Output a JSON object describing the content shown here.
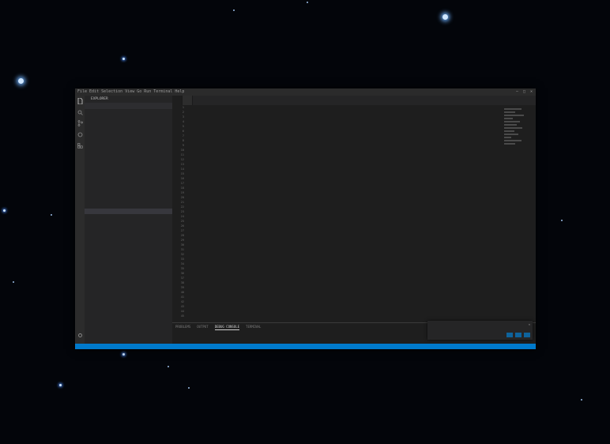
{
  "titlebar": {
    "menu": [
      "File",
      "Edit",
      "Selection",
      "View",
      "Go",
      "Run",
      "Terminal",
      "Help"
    ],
    "window_title": "",
    "controls": [
      "–",
      "□",
      "✕"
    ]
  },
  "activitybar": {
    "icons": [
      "files-icon",
      "search-icon",
      "source-control-icon",
      "debug-icon",
      "extensions-icon"
    ]
  },
  "sidebar": {
    "header": "EXPLORER",
    "section": "",
    "tree": [
      {
        "label": "",
        "indent": 6
      },
      {
        "label": "",
        "indent": 10
      },
      {
        "label": "",
        "indent": 10
      },
      {
        "label": "",
        "indent": 14
      },
      {
        "label": "",
        "indent": 14
      },
      {
        "label": "",
        "indent": 18
      },
      {
        "label": "",
        "indent": 18
      },
      {
        "label": "",
        "indent": 18
      },
      {
        "label": "",
        "indent": 22
      },
      {
        "label": "",
        "indent": 22
      },
      {
        "label": "",
        "indent": 22
      },
      {
        "label": "",
        "indent": 22
      },
      {
        "label": "",
        "indent": 22
      },
      {
        "label": "",
        "indent": 22
      },
      {
        "label": "",
        "indent": 22
      },
      {
        "label": "",
        "indent": 22
      },
      {
        "label": "",
        "indent": 22
      },
      {
        "label": "",
        "indent": 22
      },
      {
        "label": "",
        "indent": 22,
        "selected": true
      },
      {
        "label": "",
        "indent": 18
      },
      {
        "label": "",
        "indent": 18
      },
      {
        "label": "",
        "indent": 18
      },
      {
        "label": "",
        "indent": 18
      },
      {
        "label": "",
        "indent": 18
      },
      {
        "label": "",
        "indent": 18
      },
      {
        "label": "",
        "indent": 18
      },
      {
        "label": "",
        "indent": 18
      },
      {
        "label": "",
        "indent": 18
      },
      {
        "label": "",
        "indent": 18
      },
      {
        "label": "",
        "indent": 18
      },
      {
        "label": "",
        "indent": 14
      },
      {
        "label": "",
        "indent": 14
      },
      {
        "label": "",
        "indent": 14
      },
      {
        "label": "",
        "indent": 14
      },
      {
        "label": "",
        "indent": 10
      }
    ]
  },
  "tabs": [
    {
      "label": "",
      "active": true
    },
    {
      "label": "",
      "active": false
    }
  ],
  "editor": {
    "line_start": 1,
    "lines": [
      {
        "t": "            ",
        "c": "pl"
      },
      {
        "t": "            ",
        "c": "pl"
      },
      {
        "t": "            ",
        "c": "pl"
      },
      {
        "t": "            ",
        "c": "pl"
      },
      {
        "t": "            ",
        "c": "pl"
      },
      {
        "t": "            ",
        "c": "pl"
      },
      {
        "t": "            ",
        "c": "pl"
      },
      {
        "t": "            ",
        "c": "pl"
      },
      {
        "t": "",
        "c": "pl"
      },
      {
        "t": "",
        "c": "pl"
      },
      {
        "t": "      ",
        "c": "pl"
      },
      {
        "t": "",
        "c": "pl"
      },
      {
        "t": "          ",
        "c": "pl"
      },
      {
        "t": "          ",
        "c": "pl"
      },
      {
        "t": "          ",
        "c": "pl"
      },
      {
        "t": "",
        "c": "pl"
      },
      {
        "t": "",
        "c": "pl"
      },
      {
        "t": "    ",
        "c": "pl"
      },
      {
        "t": "      ",
        "c": "pl"
      },
      {
        "t": "      ",
        "c": "pl"
      },
      {
        "t": "",
        "c": "pl"
      },
      {
        "t": "    ",
        "c": "pl"
      },
      {
        "t": "    ",
        "c": "pl"
      },
      {
        "t": "",
        "c": "pl"
      },
      {
        "t": "      ",
        "c": "pl"
      },
      {
        "t": "      ",
        "c": "pl"
      },
      {
        "t": "",
        "c": "pl"
      },
      {
        "t": "",
        "c": "pl"
      },
      {
        "t": "    ",
        "c": "pl"
      },
      {
        "t": "    ",
        "c": "pl"
      },
      {
        "t": "    ",
        "c": "pl"
      },
      {
        "t": "",
        "c": "pl"
      },
      {
        "t": "  ",
        "c": "pl"
      },
      {
        "t": "  ",
        "c": "pl"
      },
      {
        "t": "",
        "c": "pl"
      },
      {
        "t": "  ",
        "c": "pl"
      },
      {
        "t": "    ",
        "c": "pl"
      },
      {
        "t": "  ",
        "c": "pl"
      },
      {
        "t": "",
        "c": "pl"
      },
      {
        "t": "  ",
        "c": "pl"
      },
      {
        "t": "",
        "c": "pl"
      },
      {
        "t": "    ",
        "c": "pl"
      },
      {
        "t": "",
        "c": "pl"
      },
      {
        "t": "  ",
        "c": "pl"
      },
      {
        "t": "",
        "c": "pl"
      }
    ]
  },
  "panel": {
    "tabs": [
      "PROBLEMS",
      "OUTPUT",
      "DEBUG CONSOLE",
      "TERMINAL"
    ],
    "active_tab": 2
  },
  "toast": {
    "message": "",
    "close": "✕",
    "buttons": [
      "",
      "",
      ""
    ]
  },
  "statusbar": {
    "left": "",
    "right": ""
  },
  "colors": {
    "statusbar": "#007acc",
    "button": "#0e639c",
    "background_space": "#03050a"
  }
}
